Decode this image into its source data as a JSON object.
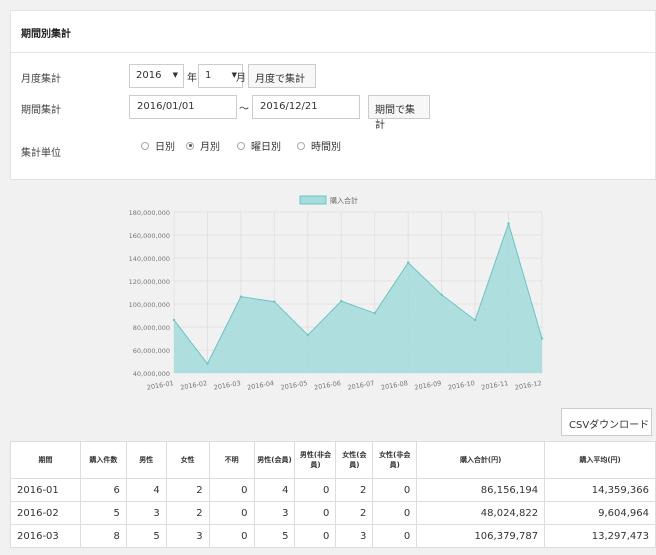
{
  "panel": {
    "title": "期間別集計",
    "monthly": {
      "label": "月度集計",
      "year_value": "2016",
      "year_suffix": "年",
      "month_value": "1",
      "month_suffix": "月",
      "button": "月度で集計"
    },
    "period": {
      "label": "期間集計",
      "from_value": "2016/01/01",
      "separator": "〜",
      "to_value": "2016/12/21",
      "button": "期間で集計"
    },
    "unit": {
      "label": "集計単位",
      "options": [
        {
          "label": "日別",
          "checked": false
        },
        {
          "label": "月別",
          "checked": true
        },
        {
          "label": "曜日別",
          "checked": false
        },
        {
          "label": "時間別",
          "checked": false
        }
      ]
    }
  },
  "chart_data": {
    "type": "area",
    "title": "",
    "xlabel": "",
    "ylabel": "",
    "categories": [
      "2016-01",
      "2016-02",
      "2016-03",
      "2016-04",
      "2016-05",
      "2016-06",
      "2016-07",
      "2016-08",
      "2016-09",
      "2016-10",
      "2016-11",
      "2016-12"
    ],
    "series": [
      {
        "name": "購入合計",
        "values": [
          86156194,
          48024822,
          106379787,
          102000000,
          73000000,
          102500000,
          92000000,
          136000000,
          108000000,
          86000000,
          170000000,
          70000000
        ]
      }
    ],
    "yticks": [
      "180,000,000",
      "160,000,000",
      "140,000,000",
      "120,000,000",
      "100,000,000",
      "80,000,000",
      "60,000,000",
      "40,000,000"
    ],
    "ylim": [
      40000000,
      180000000
    ],
    "grid": true,
    "legend_position": "top",
    "fill_color": "#a6dcdc",
    "line_color": "#6cc4c4"
  },
  "csv_button": "CSVダウンロード",
  "table": {
    "headers": [
      "期間",
      "購入件数",
      "男性",
      "女性",
      "不明",
      "男性(会員)",
      "男性(非会員)",
      "女性(会員)",
      "女性(非会員)",
      "購入合計(円)",
      "購入平均(円)"
    ],
    "rows": [
      [
        "2016-01",
        "6",
        "4",
        "2",
        "0",
        "4",
        "0",
        "2",
        "0",
        "86,156,194",
        "14,359,366"
      ],
      [
        "2016-02",
        "5",
        "3",
        "2",
        "0",
        "3",
        "0",
        "2",
        "0",
        "48,024,822",
        "9,604,964"
      ],
      [
        "2016-03",
        "8",
        "5",
        "3",
        "0",
        "5",
        "0",
        "3",
        "0",
        "106,379,787",
        "13,297,473"
      ]
    ]
  }
}
